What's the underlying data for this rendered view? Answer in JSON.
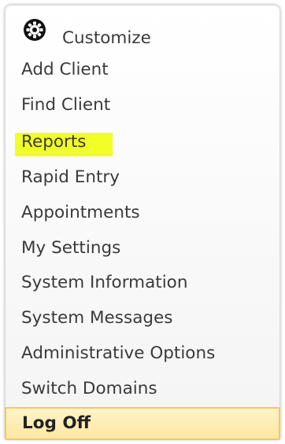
{
  "menu": {
    "customize": {
      "label": "Customize",
      "icon": "gear-icon"
    },
    "items": [
      {
        "label": "Add Client"
      },
      {
        "label": "Find Client"
      },
      {
        "label": "Reports",
        "highlighted": true
      },
      {
        "label": "Rapid Entry"
      },
      {
        "label": "Appointments"
      },
      {
        "label": "My Settings"
      },
      {
        "label": "System Information"
      },
      {
        "label": "System Messages"
      },
      {
        "label": "Administrative Options"
      },
      {
        "label": "Switch Domains"
      }
    ],
    "log_off": {
      "label": "Log Off"
    }
  },
  "colors": {
    "text": "#3a3a3a",
    "highlight": "#f2ff26",
    "log_off_bg": "#ffe7a3",
    "log_off_border": "#f5c956"
  }
}
